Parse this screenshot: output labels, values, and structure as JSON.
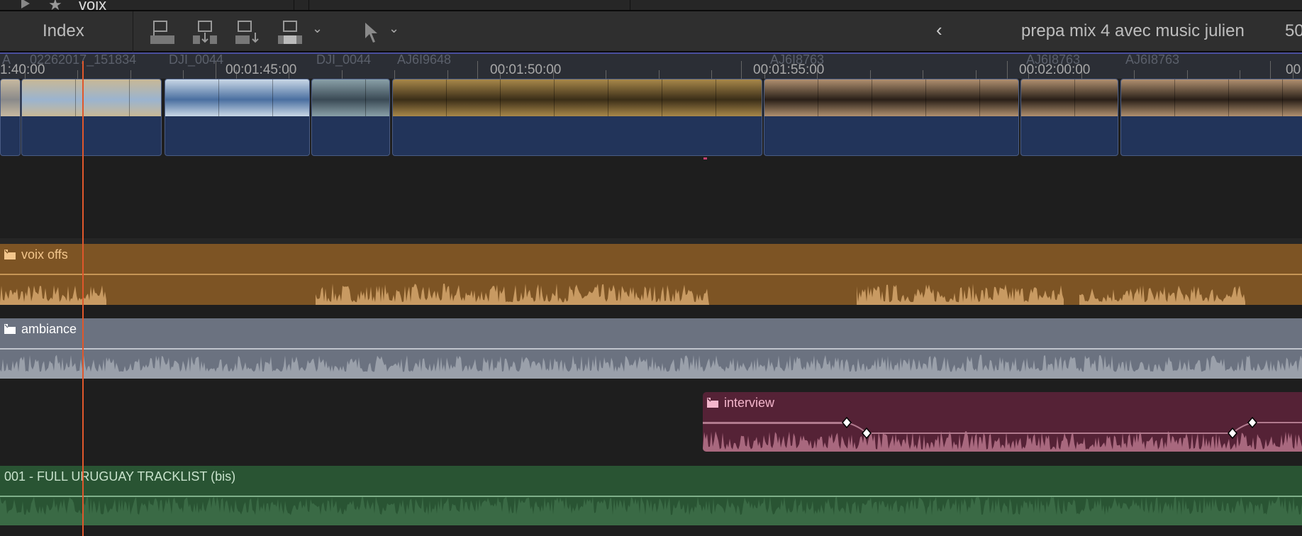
{
  "top_strip": {
    "label": "voix",
    "icons": [
      "disclosure-triangle-icon",
      "star-icon"
    ]
  },
  "toolbar": {
    "index_label": "Index",
    "edit_buttons": [
      "connect-clip-icon",
      "insert-clip-icon",
      "append-clip-icon",
      "overwrite-clip-icon"
    ],
    "tool": "select-arrow-icon",
    "back_icon": "chevron-left-icon",
    "project_title": "prepa mix 4 avec music julien",
    "zoom_partial": "50"
  },
  "ruler": {
    "timecodes": [
      "1:40:00",
      "00:01:45:00",
      "00:01:50:00",
      "00:01:55:00",
      "00:02:00:00",
      "00"
    ]
  },
  "video_clips": [
    {
      "name": "A"
    },
    {
      "name": "02262017_151834"
    },
    {
      "name": "DJI_0044"
    },
    {
      "name": "DJI_0044"
    },
    {
      "name": "AJ6I9648"
    },
    {
      "name": "AJ6I8763"
    },
    {
      "name": "AJ6I8763"
    },
    {
      "name": "AJ6I8763"
    }
  ],
  "audio_lanes": [
    {
      "role": "voix offs",
      "color": "#7d5424",
      "wave": "#c89a62",
      "text": "#f3c68c"
    },
    {
      "role": "ambiance",
      "color": "#6b7280",
      "wave": "#9aa0aa",
      "text": "#ffffff"
    },
    {
      "role": "interview",
      "color": "#552236",
      "wave": "#a8687e",
      "text": "#f4b6cc"
    },
    {
      "role": "001 - FULL URUGUAY TRACKLIST (bis)",
      "color": "#295433",
      "wave": "#3a6a45",
      "text": "#c8e2cc"
    }
  ],
  "playhead_color": "#e0572b"
}
